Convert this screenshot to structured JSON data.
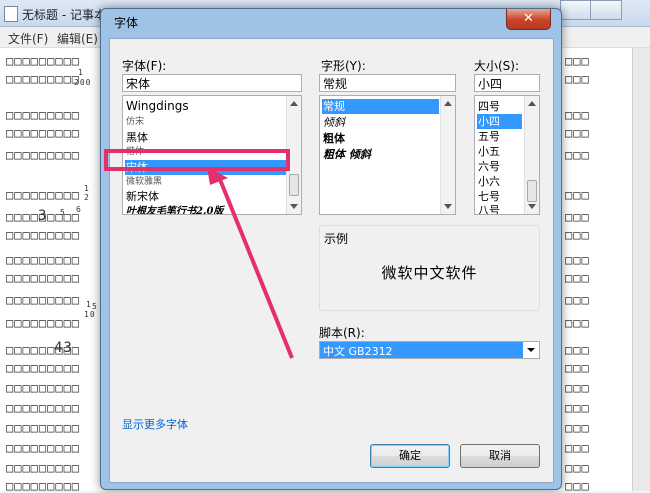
{
  "notepad": {
    "title": "无标题 - 记事本",
    "menus": [
      "文件(F)",
      "编辑(E)"
    ],
    "lines_left": [
      "□□□□□□□□□",
      "□□□□□□□□□",
      "□□□□□□□□□",
      "□□□□□□□□□",
      "□□□□□□□□□",
      "□□□□□□□□□",
      "□□□□□□□□□",
      "□□□□□□□□□",
      "□□□□□□□□□",
      "□□□□□□□□□",
      "□□□□□□□□□",
      "□□□□□□□□□",
      "□□□□□□□□□",
      "□□□□□□□□□",
      "□□□□□□□□□",
      "□□□□□□□□□",
      "□□□□□□□□□",
      "□□□□□□□□□",
      "□□□□□□□□□",
      "□□□□□□□□□"
    ],
    "lines_right": [
      "□□□",
      "□□□",
      "□□□",
      "□□□",
      "□□□",
      "□□□",
      "□□□",
      "□□□",
      "□□□",
      "□□□",
      "□□□",
      "□□□",
      "□□□",
      "□□□",
      "□□□",
      "□□□",
      "□□□",
      "□□□",
      "□□□",
      "□□□",
      "□□□",
      "□□□",
      "□□□",
      "□□□"
    ],
    "fragments": [
      "1",
      "200",
      "1",
      "2",
      "6",
      "3",
      "5",
      "1",
      "10",
      "5",
      "43"
    ]
  },
  "dialog": {
    "title": "字体",
    "close_label": "✕",
    "font_label": "字体(F):",
    "font_value": "宋体",
    "font_list": [
      "Wingdings",
      "仿宋",
      "黑体",
      "楷体",
      "宋体",
      "微软雅黑",
      "新宋体",
      "叶根友毛笔行书2.0版"
    ],
    "font_selected_index": 4,
    "style_label": "字形(Y):",
    "style_value": "常规",
    "style_list": [
      "常规",
      "倾斜",
      "粗体",
      "粗体 倾斜"
    ],
    "style_selected_index": 0,
    "size_label": "大小(S):",
    "size_value": "小四",
    "size_list": [
      "四号",
      "小四",
      "五号",
      "小五",
      "六号",
      "小六",
      "七号",
      "八号"
    ],
    "size_selected_index": 1,
    "sample_label": "示例",
    "sample_text": "微软中文软件",
    "script_label": "脚本(R):",
    "script_value": "中文 GB2312",
    "more_fonts_link": "显示更多字体",
    "ok_label": "确定",
    "cancel_label": "取消"
  },
  "colors": {
    "selection": "#3399ff",
    "annotation": "#e3306b",
    "link": "#0066cc"
  }
}
